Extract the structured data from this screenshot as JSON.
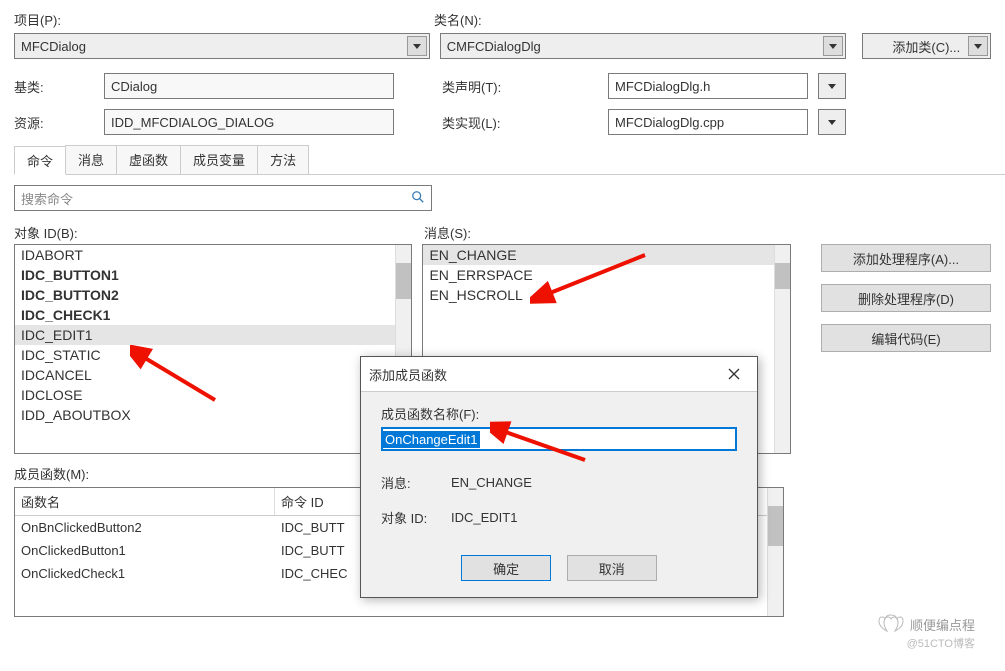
{
  "header": {
    "project_label": "项目(P):",
    "classname_label": "类名(N):",
    "project_value": "MFCDialog",
    "classname_value": "CMFCDialogDlg",
    "addclass_label": "添加类(C)..."
  },
  "info": {
    "base_label": "基类:",
    "base_value": "CDialog",
    "res_label": "资源:",
    "res_value": "IDD_MFCDIALOG_DIALOG",
    "decl_label": "类声明(T):",
    "decl_value": "MFCDialogDlg.h",
    "impl_label": "类实现(L):",
    "impl_value": "MFCDialogDlg.cpp"
  },
  "tabs": [
    "命令",
    "消息",
    "虚函数",
    "成员变量",
    "方法"
  ],
  "search": {
    "placeholder": "搜索命令"
  },
  "objects": {
    "label": "对象 ID(B):",
    "items": [
      {
        "t": "IDABORT",
        "b": false,
        "s": false
      },
      {
        "t": "IDC_BUTTON1",
        "b": true,
        "s": false
      },
      {
        "t": "IDC_BUTTON2",
        "b": true,
        "s": false
      },
      {
        "t": "IDC_CHECK1",
        "b": true,
        "s": false
      },
      {
        "t": "IDC_EDIT1",
        "b": false,
        "s": true
      },
      {
        "t": "IDC_STATIC",
        "b": false,
        "s": false
      },
      {
        "t": "IDCANCEL",
        "b": false,
        "s": false
      },
      {
        "t": "IDCLOSE",
        "b": false,
        "s": false
      },
      {
        "t": "IDD_ABOUTBOX",
        "b": false,
        "s": false
      }
    ]
  },
  "messages": {
    "label": "消息(S):",
    "items": [
      {
        "t": "EN_CHANGE",
        "s": true
      },
      {
        "t": "EN_ERRSPACE",
        "s": false
      },
      {
        "t": "EN_HSCROLL",
        "s": false
      }
    ]
  },
  "actions": {
    "add": "添加处理程序(A)...",
    "del": "删除处理程序(D)",
    "edit": "编辑代码(E)"
  },
  "members": {
    "label": "成员函数(M):",
    "cols": [
      "函数名",
      "命令 ID"
    ],
    "rows": [
      {
        "fn": "OnBnClickedButton2",
        "id": "IDC_BUTT"
      },
      {
        "fn": "OnClickedButton1",
        "id": "IDC_BUTT"
      },
      {
        "fn": "OnClickedCheck1",
        "id": "IDC_CHEC"
      }
    ]
  },
  "dialog": {
    "title": "添加成员函数",
    "name_label": "成员函数名称(F):",
    "name_value": "OnChangeEdit1",
    "msg_label": "消息:",
    "msg_value": "EN_CHANGE",
    "oid_label": "对象 ID:",
    "oid_value": "IDC_EDIT1",
    "ok": "确定",
    "cancel": "取消"
  },
  "watermark": {
    "main": "顺便编点程",
    "sub": "@51CTO博客"
  }
}
